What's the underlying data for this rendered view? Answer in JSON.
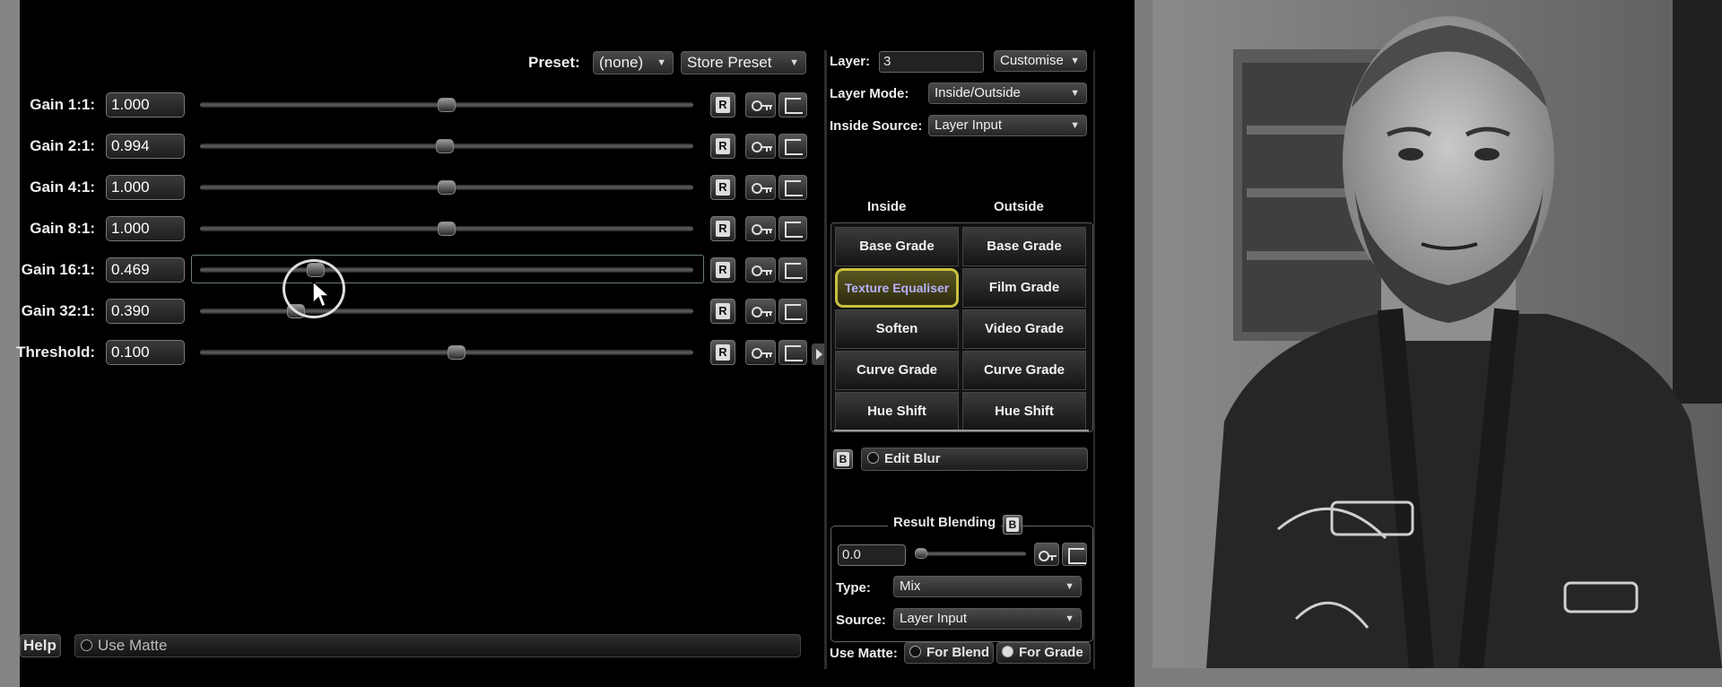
{
  "preset": {
    "label": "Preset:",
    "value": "(none)",
    "store_label": "Store Preset"
  },
  "gain_rows": [
    {
      "label": "Gain 1:1:",
      "value": "1.000",
      "fraction": 0.5
    },
    {
      "label": "Gain 2:1:",
      "value": "0.994",
      "fraction": 0.497
    },
    {
      "label": "Gain 4:1:",
      "value": "1.000",
      "fraction": 0.5
    },
    {
      "label": "Gain 8:1:",
      "value": "1.000",
      "fraction": 0.5
    },
    {
      "label": "Gain 16:1:",
      "value": "0.469",
      "fraction": 0.235
    },
    {
      "label": "Gain 32:1:",
      "value": "0.390",
      "fraction": 0.195
    },
    {
      "label": "Threshold:",
      "value": "0.100",
      "fraction": 0.52
    }
  ],
  "row_buttons": {
    "reset_label": "R"
  },
  "bottom": {
    "help_label": "Help",
    "use_matte_label": "Use Matte"
  },
  "layer": {
    "label": "Layer:",
    "value": "3",
    "customise_label": "Customise",
    "mode_label": "Layer Mode:",
    "mode_value": "Inside/Outside",
    "inside_source_label": "Inside Source:",
    "inside_source_value": "Layer Input"
  },
  "grades": {
    "inside_header": "Inside",
    "outside_header": "Outside",
    "inside": [
      "Base Grade",
      "Texture Equaliser",
      "Soften",
      "Curve Grade",
      "Hue Shift"
    ],
    "outside": [
      "Base Grade",
      "Film Grade",
      "Video Grade",
      "Curve Grade",
      "Hue Shift"
    ]
  },
  "edit_blur": {
    "b_label": "B",
    "label": "Edit Blur"
  },
  "result_blending": {
    "title": "Result Blending",
    "b_label": "B",
    "value": "0.0",
    "type_label": "Type:",
    "type_value": "Mix",
    "source_label": "Source:",
    "source_value": "Layer Input"
  },
  "use_matte_row": {
    "label": "Use Matte:",
    "for_blend": "For Blend",
    "for_grade": "For Grade"
  },
  "colors": {
    "highlight": "#c8c040",
    "highlight_text": "#b8b0ff",
    "background": "#000000"
  }
}
